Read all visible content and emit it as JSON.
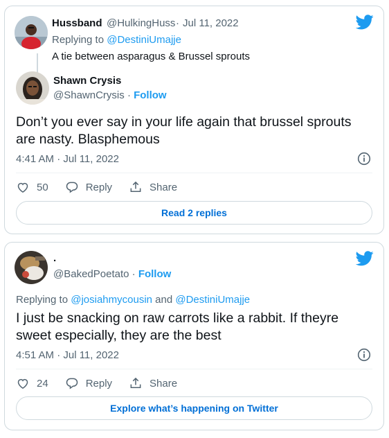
{
  "tweet1": {
    "parent": {
      "name": "Hussband",
      "handle": "@HulkingHuss",
      "date": "Jul 11, 2022",
      "replying_prefix": "Replying to",
      "replying_to": "@DestiniUmajje",
      "text": "A tie between asparagus & Brussel sprouts"
    },
    "author": {
      "name": "Shawn Crysis",
      "handle": "@ShawnCrysis",
      "follow_label": "Follow"
    },
    "text": "Don’t you ever say in your life again that brussel sprouts are nasty. Blasphemous",
    "timestamp": "4:41 AM · Jul 11, 2022",
    "likes": "50",
    "reply_label": "Reply",
    "share_label": "Share",
    "button_label": "Read 2 replies"
  },
  "tweet2": {
    "author": {
      "name": ".",
      "handle": "@BakedPoetato",
      "follow_label": "Follow"
    },
    "replying_prefix": "Replying to",
    "replying_to_1": "@josiahmycousin",
    "replying_and": "and",
    "replying_to_2": "@DestiniUmajje",
    "text": "I just be snacking on raw carrots like a rabbit. If theyre sweet especially, they are the best",
    "timestamp": "4:51 AM · Jul 11, 2022",
    "likes": "24",
    "reply_label": "Reply",
    "share_label": "Share",
    "button_label": "Explore what’s happening on Twitter"
  },
  "colors": {
    "accent": "#1d9bf0",
    "link_dark": "#006fd6",
    "secondary_text": "#536471",
    "border": "#cfd9de"
  },
  "icons": [
    "twitter-bird-icon",
    "info-icon",
    "heart-icon",
    "reply-bubble-icon",
    "share-icon"
  ]
}
